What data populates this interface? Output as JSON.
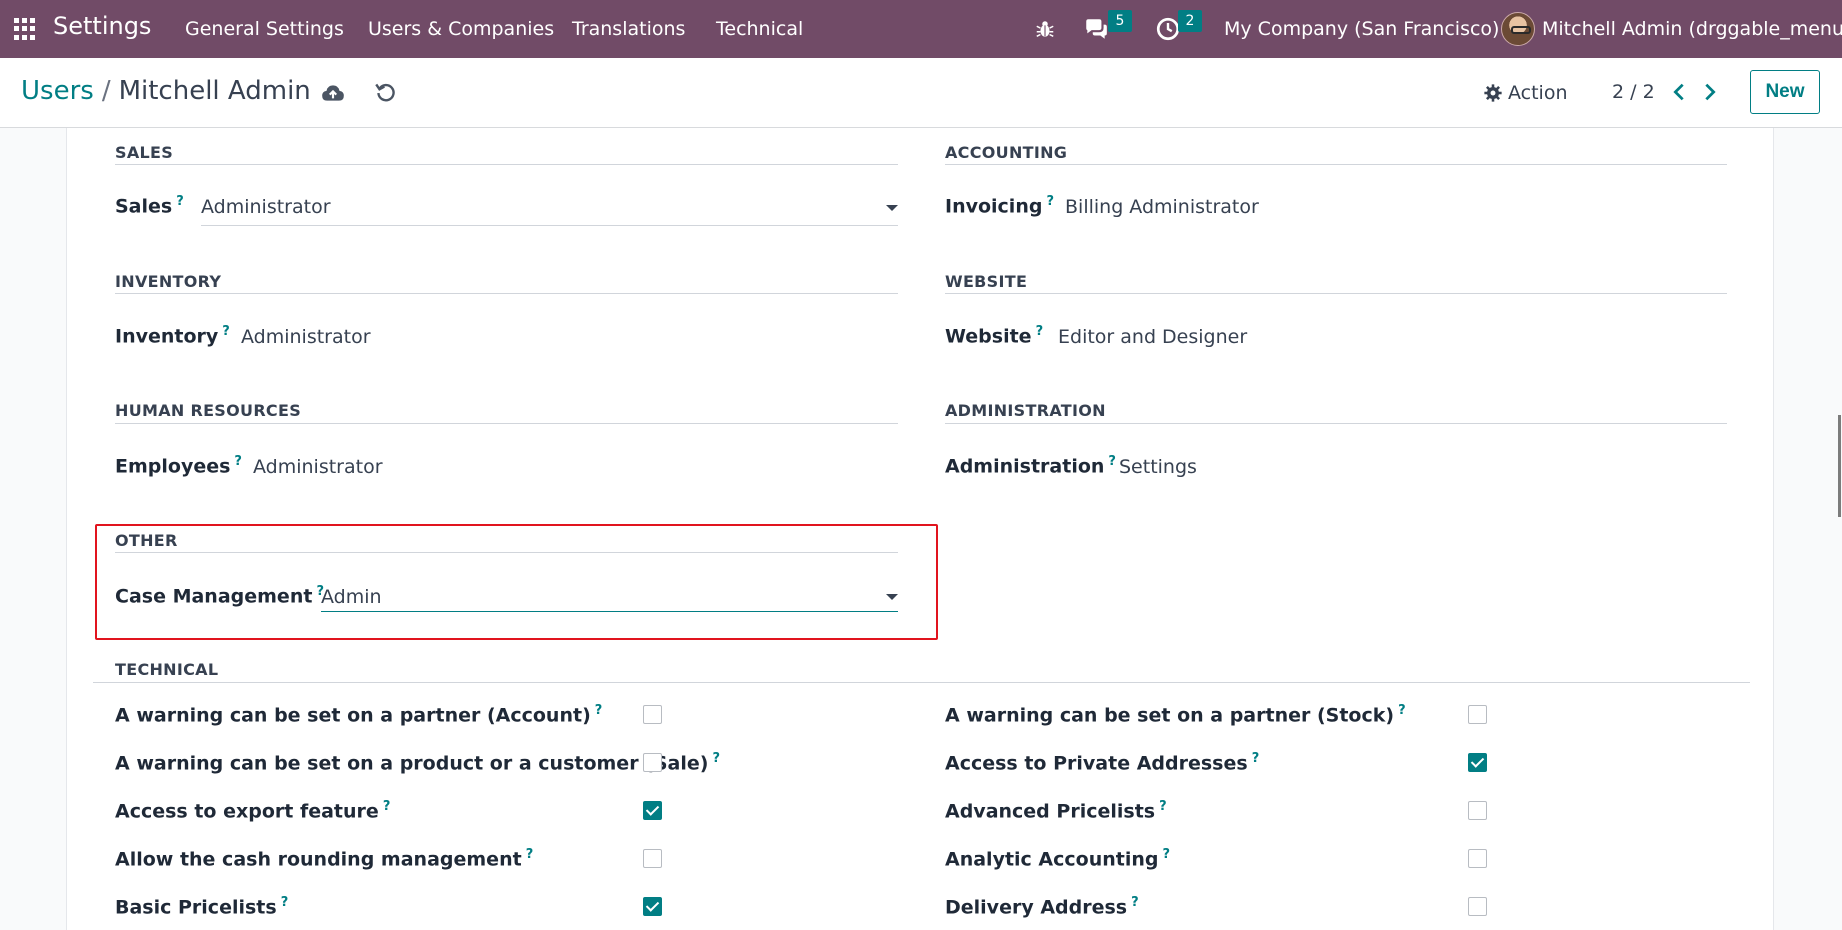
{
  "navbar": {
    "app_title": "Settings",
    "menu": [
      "General Settings",
      "Users & Companies",
      "Translations",
      "Technical"
    ],
    "messages_count": "5",
    "activities_count": "2",
    "company": "My Company (San Francisco)",
    "user": "Mitchell Admin (drggable_menu)"
  },
  "control": {
    "breadcrumb_parent": "Users",
    "breadcrumb_sep": "/",
    "breadcrumb_current": "Mitchell Admin",
    "action_label": "Action",
    "pager": "2 / 2",
    "new_label": "New"
  },
  "groups": {
    "sales": {
      "title": "SALES",
      "label": "Sales",
      "value": "Administrator"
    },
    "accounting": {
      "title": "ACCOUNTING",
      "label": "Invoicing",
      "value": "Billing Administrator"
    },
    "inventory": {
      "title": "INVENTORY",
      "label": "Inventory",
      "value": "Administrator"
    },
    "website": {
      "title": "WEBSITE",
      "label": "Website",
      "value": "Editor and Designer"
    },
    "hr": {
      "title": "HUMAN RESOURCES",
      "label": "Employees",
      "value": "Administrator"
    },
    "administration": {
      "title": "ADMINISTRATION",
      "label": "Administration",
      "value": "Settings"
    },
    "other": {
      "title": "OTHER",
      "label": "Case Management",
      "value": "Admin"
    }
  },
  "technical": {
    "title": "TECHNICAL",
    "left": [
      {
        "label": "A warning can be set on a partner (Account)",
        "checked": false
      },
      {
        "label": "A warning can be set on a product or a customer (Sale)",
        "checked": false
      },
      {
        "label": "Access to export feature",
        "checked": true
      },
      {
        "label": "Allow the cash rounding management",
        "checked": false
      },
      {
        "label": "Basic Pricelists",
        "checked": true
      }
    ],
    "right": [
      {
        "label": "A warning can be set on a partner (Stock)",
        "checked": false
      },
      {
        "label": "Access to Private Addresses",
        "checked": true
      },
      {
        "label": "Advanced Pricelists",
        "checked": false
      },
      {
        "label": "Analytic Accounting",
        "checked": false
      },
      {
        "label": "Delivery Address",
        "checked": false
      }
    ]
  },
  "help_mark": "?"
}
